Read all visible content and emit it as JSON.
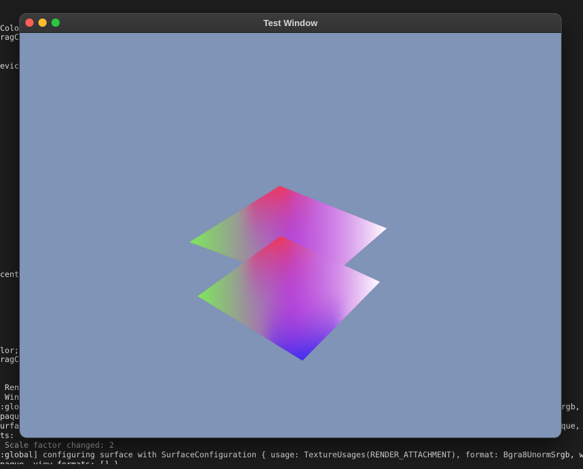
{
  "terminal": {
    "left_fragments": [
      "Colo",
      "ragC",
      "evic",
      "cent",
      "lor;",
      "ragC",
      " Ren",
      " Win",
      ":glo",
      "paqu",
      "urfa",
      "ts: "
    ],
    "right_fragments": [
      "rgb, w",
      "que,"
    ],
    "scale_line": " Scale factor changed: 2",
    "configure_line": ":global] configuring surface with SurfaceConfiguration { usage: TextureUsages(RENDER_ATTACHMENT), format: Bgra8UnormSrgb, w",
    "partial_line": "paque, view_formats: [] }"
  },
  "window": {
    "title": "Test Window",
    "background_color": "#7f94b6",
    "controls": {
      "close_color": "#fe5f57",
      "minimize_color": "#febc2e",
      "zoom_color": "#28c840"
    }
  },
  "scene": {
    "vertex_colors": {
      "left": "#7ee85a",
      "top": "#ee3a55",
      "right": "#ffffff",
      "bottom": "#3a2ef0",
      "center": "#b540d8"
    }
  }
}
